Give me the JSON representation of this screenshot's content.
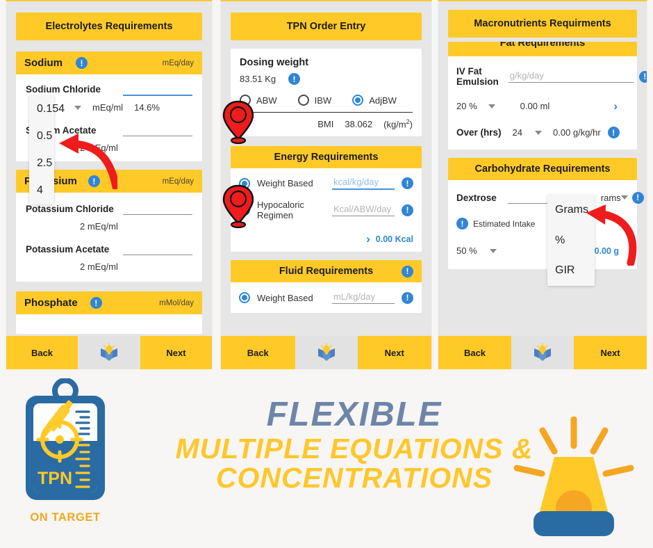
{
  "theme": {
    "yellow": "#ffca28",
    "blue": "#2b87d8",
    "logo_blue": "#2a6ba3",
    "text_blue_grey": "#6d86a8",
    "red_pin": "#ee1c1c"
  },
  "panel1": {
    "title": "Electrolytes Requirements",
    "sections": [
      {
        "name": "Sodium",
        "unit": "mEq/day",
        "rows": [
          {
            "label": "Sodium Chloride",
            "value": "",
            "conc": "mEq/ml",
            "percent": "14.6%",
            "focused": true
          },
          {
            "label": "Sodium Acetate",
            "value": "",
            "conc": "2 mEq/ml",
            "focused": false
          }
        ]
      },
      {
        "name": "Potassium",
        "unit": "mEq/day",
        "rows": [
          {
            "label": "Potassium Chloride",
            "value": "",
            "conc": "2 mEq/ml",
            "focused": false
          },
          {
            "label": "Potassium Acetate",
            "value": "",
            "conc": "2 mEq/ml",
            "focused": false
          }
        ]
      },
      {
        "name": "Phosphate",
        "unit": "mMol/day",
        "rows": []
      }
    ],
    "dropdown": {
      "options": [
        "0.154",
        "0.5",
        "2.5",
        "4"
      ]
    },
    "nav": {
      "back": "Back",
      "next": "Next",
      "mid_icon": "lightbulb-tips-icon"
    }
  },
  "panel2": {
    "title": "TPN Order Entry",
    "dosing": {
      "label": "Dosing weight",
      "weight": "83.51 Kg",
      "options": [
        {
          "label": "ABW",
          "selected": false
        },
        {
          "label": "IBW",
          "selected": false
        },
        {
          "label": "AdjBW",
          "selected": true
        }
      ],
      "bmi_label": "BMI",
      "bmi_value": "38.062",
      "bmi_unit": "(kg/m",
      "bmi_unit_sup": "2",
      "bmi_unit_end": ")"
    },
    "energy": {
      "title": "Energy Requirements",
      "options": [
        {
          "label": "Weight Based",
          "selected": true,
          "placeholder": "kcal/kg/day",
          "value": "",
          "focused": true
        },
        {
          "label": "Hypocaloric Regimen",
          "selected": false,
          "placeholder": "Kcal/ABW/day",
          "value": "",
          "focused": false
        }
      ],
      "result": "0.00 Kcal"
    },
    "fluid": {
      "title": "Fluid Requirements",
      "options": [
        {
          "label": "Weight Based",
          "selected": true,
          "placeholder": "mL/kg/day",
          "value": ""
        }
      ]
    },
    "nav": {
      "back": "Back",
      "next": "Next",
      "mid_icon": "lightbulb-tips-icon"
    }
  },
  "panel3": {
    "title": "Macronutrients Requirments",
    "fat": {
      "title": "Fat Requirements",
      "row_label": "IV Fat Emulsion",
      "row_placeholder": "g/kg/day",
      "row_value": "",
      "concentration": "20 %",
      "volume": "0.00 ml",
      "over_label": "Over (hrs)",
      "over_value": "24",
      "rate": "0.00 g/kg/hr"
    },
    "carb": {
      "title": "Carbohydrate Requirements",
      "row_label": "Dextrose",
      "row_value": "",
      "unit_selected": "Grams",
      "unit_behind": "rams",
      "estimated_label": "Estimated Intake",
      "concentration": "50 %",
      "result": "0.00 g",
      "dropdown": {
        "options": [
          "Grams",
          "%",
          "GIR"
        ]
      }
    },
    "nav": {
      "back": "Back",
      "next": "Next",
      "mid_icon": "lightbulb-tips-icon"
    }
  },
  "banner": {
    "logo_text": "TPN",
    "logo_caption": "ON TARGET",
    "headline": "FLEXIBLE",
    "line2": "MULTIPLE EQUATIONS &",
    "line3": "CONCENTRATIONS",
    "siren_icon": "siren-beacon-icon"
  }
}
